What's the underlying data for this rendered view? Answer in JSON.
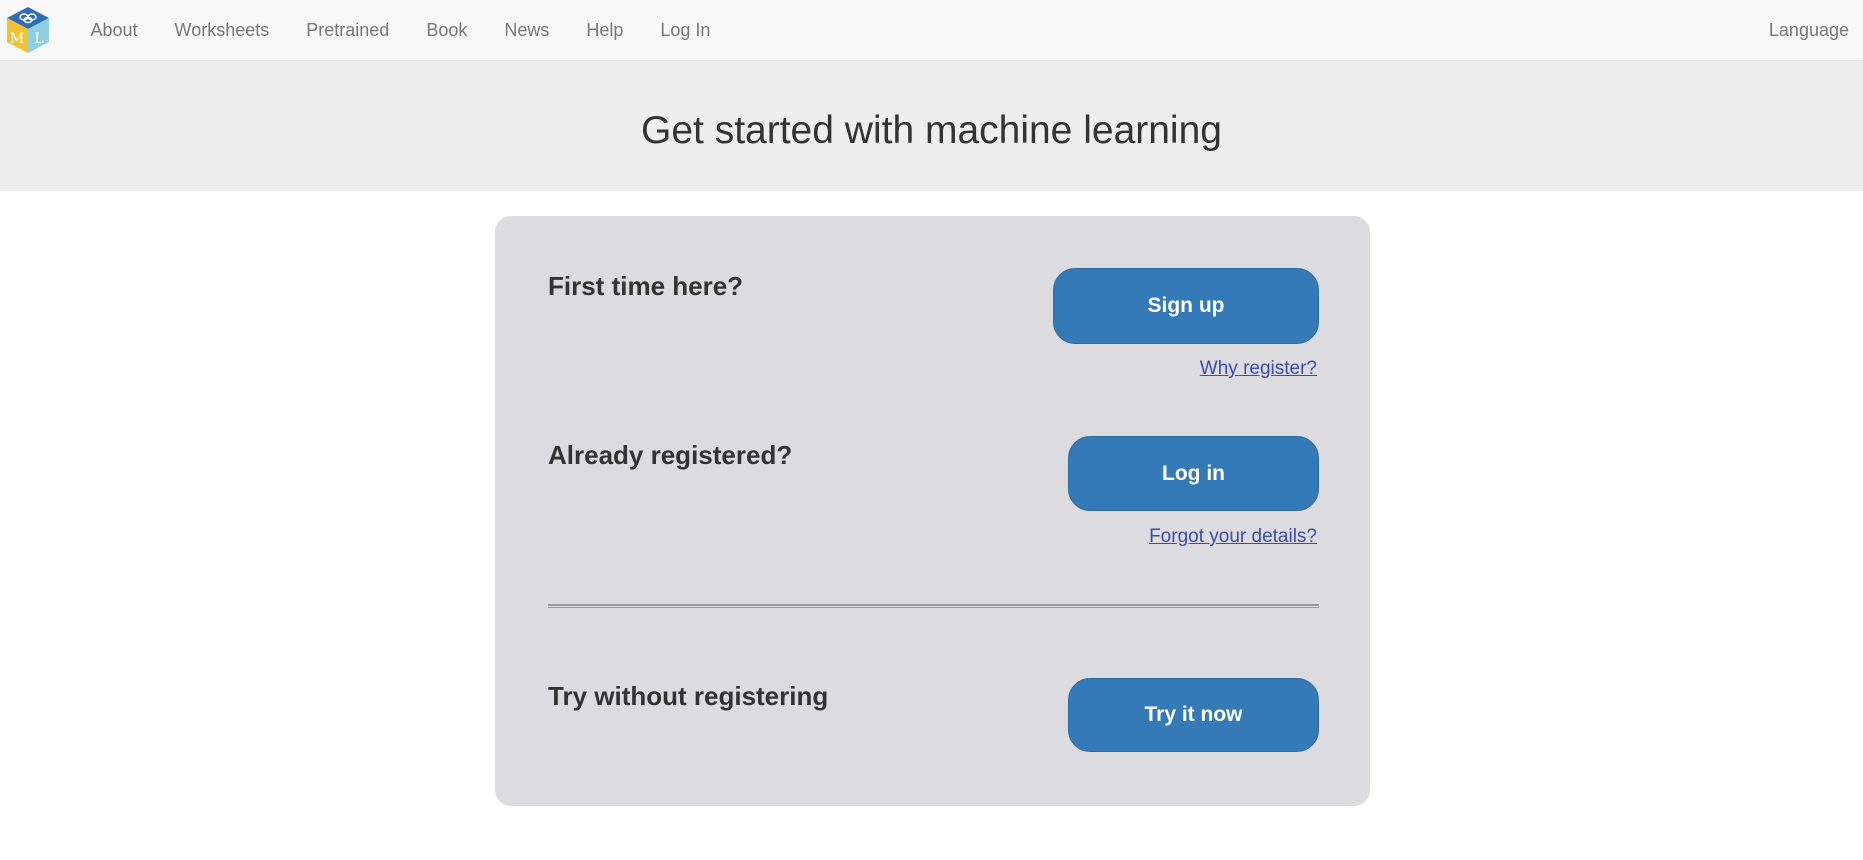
{
  "nav": {
    "logo_letters": [
      "M",
      "L"
    ],
    "links": [
      {
        "label": "About"
      },
      {
        "label": "Worksheets"
      },
      {
        "label": "Pretrained"
      },
      {
        "label": "Book"
      },
      {
        "label": "News"
      },
      {
        "label": "Help"
      },
      {
        "label": "Log In"
      }
    ],
    "language_label": "Language"
  },
  "hero": {
    "title": "Get started with machine learning"
  },
  "panel": {
    "signup": {
      "heading": "First time here?",
      "button_label": "Sign up",
      "link_label": "Why register?"
    },
    "login": {
      "heading": "Already registered?",
      "button_label": "Log in",
      "link_label": "Forgot your details?"
    },
    "try": {
      "heading": "Try without registering",
      "button_label": "Try it now"
    }
  },
  "colors": {
    "primary_button": "#337ab7",
    "panel_background": "#dcdbe0",
    "link": "#3b4ea8",
    "hero_background": "#eeeeee",
    "navbar_background": "#f8f8f8"
  }
}
